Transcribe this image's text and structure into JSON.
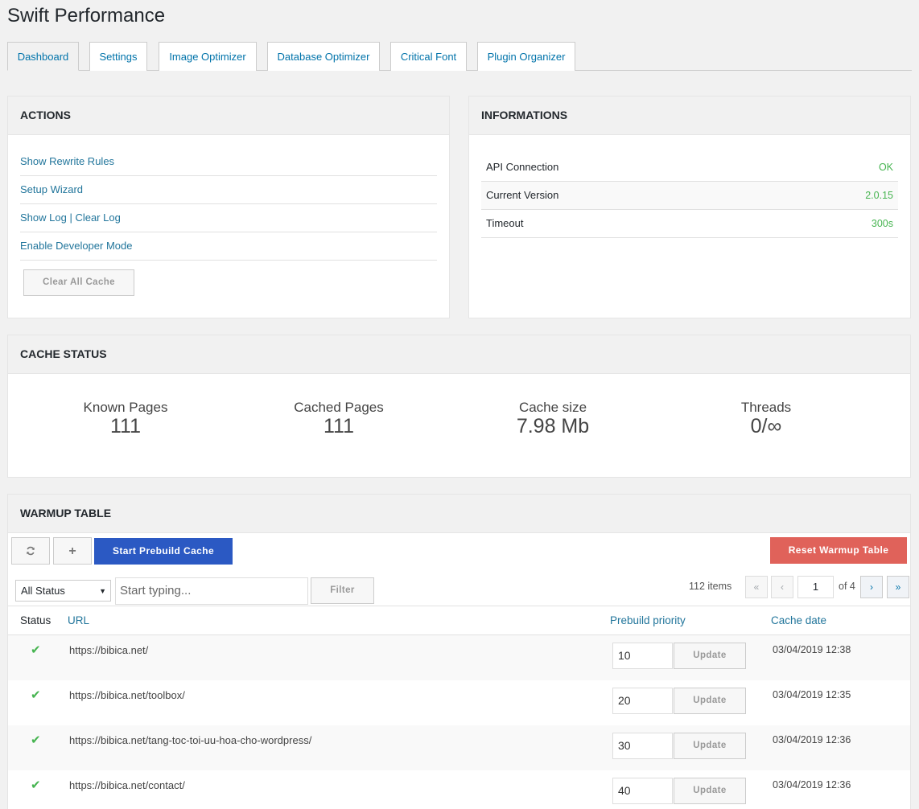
{
  "page_title": "Swift Performance",
  "tabs": [
    "Dashboard",
    "Settings",
    "Image Optimizer",
    "Database Optimizer",
    "Critical Font",
    "Plugin Organizer"
  ],
  "active_tab": "Dashboard",
  "actions": {
    "title": "ACTIONS",
    "items": [
      "Show Rewrite Rules",
      "Setup Wizard",
      "Enable Developer Mode"
    ],
    "log": {
      "show": "Show Log",
      "separator": " | ",
      "clear": "Clear Log"
    },
    "clear_cache_label": "Clear All Cache"
  },
  "informations": {
    "title": "INFORMATIONS",
    "rows": [
      {
        "label": "API Connection",
        "value": "OK"
      },
      {
        "label": "Current Version",
        "value": "2.0.15"
      },
      {
        "label": "Timeout",
        "value": "300s"
      }
    ]
  },
  "cache_status": {
    "title": "CACHE STATUS",
    "stats": [
      {
        "label": "Known Pages",
        "value": "111"
      },
      {
        "label": "Cached Pages",
        "value": "111"
      },
      {
        "label": "Cache size",
        "value": "7.98 Mb"
      },
      {
        "label": "Threads",
        "value": "0/∞"
      }
    ]
  },
  "warmup": {
    "title": "WARMUP TABLE",
    "refresh_icon": "refresh-icon",
    "add_icon": "plus-icon",
    "start_label": "Start Prebuild Cache",
    "reset_label": "Reset Warmup Table",
    "status_select": "All Status",
    "search_placeholder": "Start typing...",
    "filter_label": "Filter",
    "items_count": "112 items",
    "page_current": "1",
    "page_total": "of 4",
    "pager": {
      "first": "«",
      "prev": "‹",
      "next": "›",
      "last": "»"
    },
    "columns": {
      "status": "Status",
      "url": "URL",
      "priority": "Prebuild priority",
      "date": "Cache date"
    },
    "update_label": "Update",
    "rows": [
      {
        "url": "https://bibica.net/",
        "priority": "10",
        "date": "03/04/2019 12:38"
      },
      {
        "url": "https://bibica.net/toolbox/",
        "priority": "20",
        "date": "03/04/2019 12:35"
      },
      {
        "url": "https://bibica.net/tang-toc-toi-uu-hoa-cho-wordpress/",
        "priority": "30",
        "date": "03/04/2019 12:36"
      },
      {
        "url": "https://bibica.net/contact/",
        "priority": "40",
        "date": "03/04/2019 12:36"
      }
    ]
  },
  "colors": {
    "accent": "#2b59c3",
    "link": "#21759b",
    "ok": "#46b450",
    "danger": "#e0625a"
  }
}
